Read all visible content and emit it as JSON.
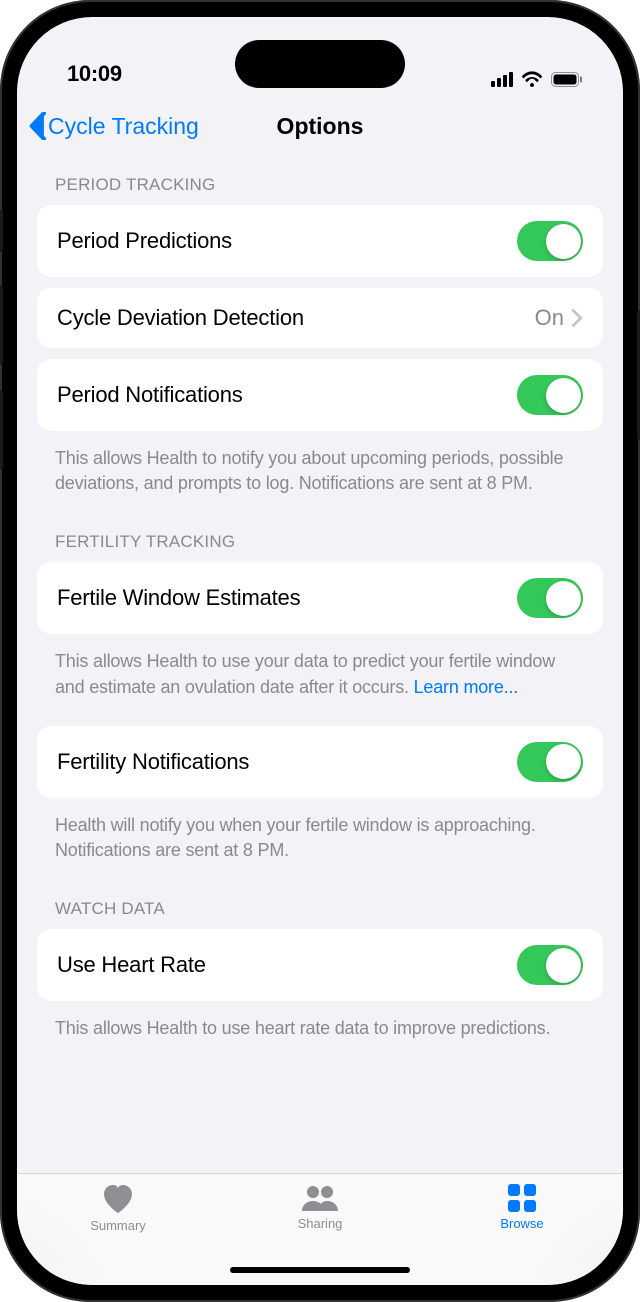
{
  "status": {
    "time": "10:09"
  },
  "nav": {
    "back": "Cycle Tracking",
    "title": "Options"
  },
  "sections": {
    "period": {
      "header": "PERIOD TRACKING",
      "rows": {
        "predictions": "Period Predictions",
        "deviation": "Cycle Deviation Detection",
        "deviation_value": "On",
        "notifications": "Period Notifications"
      },
      "footer": "This allows Health to notify you about upcoming periods, possible deviations, and prompts to log. Notifications are sent at 8 PM."
    },
    "fertility": {
      "header": "FERTILITY TRACKING",
      "rows": {
        "estimates": "Fertile Window Estimates",
        "notifications": "Fertility Notifications"
      },
      "footer1_a": "This allows Health to use your data to predict your fertile window and estimate an ovulation date after it occurs. ",
      "footer1_link": "Learn more...",
      "footer2": "Health will notify you when your fertile window is approaching. Notifications are sent at 8 PM."
    },
    "watch": {
      "header": "WATCH DATA",
      "rows": {
        "heartrate": "Use Heart Rate"
      },
      "footer": "This allows Health to use heart rate data to improve predictions."
    }
  },
  "tabs": {
    "summary": "Summary",
    "sharing": "Sharing",
    "browse": "Browse"
  }
}
